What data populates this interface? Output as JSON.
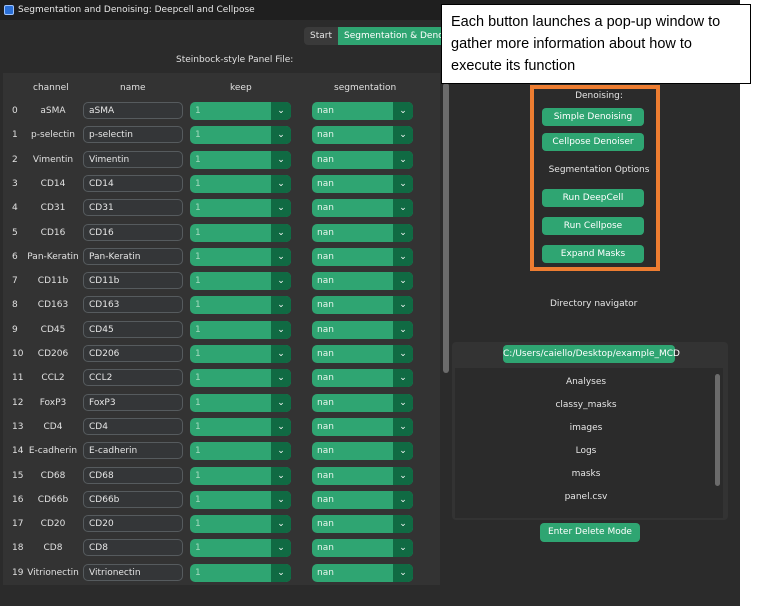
{
  "window": {
    "title": "Segmentation and Denoising: Deepcell and Cellpose"
  },
  "tabs": [
    {
      "label": "Start"
    },
    {
      "label": "Segmentation & Denoising"
    }
  ],
  "panel_file_label": "Steinbock-style Panel File:",
  "table": {
    "headers": {
      "channel": "channel",
      "name": "name",
      "keep": "keep",
      "segmentation": "segmentation"
    },
    "rows": [
      {
        "index": "0",
        "channel": "aSMA",
        "name": "aSMA",
        "keep": "1",
        "segmentation": "nan"
      },
      {
        "index": "1",
        "channel": "p-selectin",
        "name": "p-selectin",
        "keep": "1",
        "segmentation": "nan"
      },
      {
        "index": "2",
        "channel": "Vimentin",
        "name": "Vimentin",
        "keep": "1",
        "segmentation": "nan"
      },
      {
        "index": "3",
        "channel": "CD14",
        "name": "CD14",
        "keep": "1",
        "segmentation": "nan"
      },
      {
        "index": "4",
        "channel": "CD31",
        "name": "CD31",
        "keep": "1",
        "segmentation": "nan"
      },
      {
        "index": "5",
        "channel": "CD16",
        "name": "CD16",
        "keep": "1",
        "segmentation": "nan"
      },
      {
        "index": "6",
        "channel": "Pan-Keratin",
        "name": "Pan-Keratin",
        "keep": "1",
        "segmentation": "nan"
      },
      {
        "index": "7",
        "channel": "CD11b",
        "name": "CD11b",
        "keep": "1",
        "segmentation": "nan"
      },
      {
        "index": "8",
        "channel": "CD163",
        "name": "CD163",
        "keep": "1",
        "segmentation": "nan"
      },
      {
        "index": "9",
        "channel": "CD45",
        "name": "CD45",
        "keep": "1",
        "segmentation": "nan"
      },
      {
        "index": "10",
        "channel": "CD206",
        "name": "CD206",
        "keep": "1",
        "segmentation": "nan"
      },
      {
        "index": "11",
        "channel": "CCL2",
        "name": "CCL2",
        "keep": "1",
        "segmentation": "nan"
      },
      {
        "index": "12",
        "channel": "FoxP3",
        "name": "FoxP3",
        "keep": "1",
        "segmentation": "nan"
      },
      {
        "index": "13",
        "channel": "CD4",
        "name": "CD4",
        "keep": "1",
        "segmentation": "nan"
      },
      {
        "index": "14",
        "channel": "E-cadherin",
        "name": "E-cadherin",
        "keep": "1",
        "segmentation": "nan"
      },
      {
        "index": "15",
        "channel": "CD68",
        "name": "CD68",
        "keep": "1",
        "segmentation": "nan"
      },
      {
        "index": "16",
        "channel": "CD66b",
        "name": "CD66b",
        "keep": "1",
        "segmentation": "nan"
      },
      {
        "index": "17",
        "channel": "CD20",
        "name": "CD20",
        "keep": "1",
        "segmentation": "nan"
      },
      {
        "index": "18",
        "channel": "CD8",
        "name": "CD8",
        "keep": "1",
        "segmentation": "nan"
      },
      {
        "index": "19",
        "channel": "Vitrionectin",
        "name": "Vitrionectin",
        "keep": "1",
        "segmentation": "nan"
      }
    ]
  },
  "callout": {
    "text": "Each button launches a pop-up window to gather more information about how to execute its function"
  },
  "actions": {
    "denoising_label": "Denoising:",
    "simple_denoising": "Simple Denoising",
    "cellpose_denoiser": "Cellpose Denoiser",
    "segmentation_label": "Segmentation Options",
    "run_deepcell": "Run DeepCell",
    "run_cellpose": "Run Cellpose",
    "expand_masks": "Expand Masks"
  },
  "directory": {
    "label": "Directory navigator",
    "path": "C:/Users/caiello/Desktop/example_MCD",
    "items": [
      "Analyses",
      "classy_masks",
      "images",
      "Logs",
      "masks",
      "panel.csv"
    ],
    "delete_button": "Enter Delete Mode"
  },
  "colors": {
    "accent": "#2fa572",
    "accent_dark": "#106a43",
    "highlight": "#ed7d31",
    "background": "#2b2b2b"
  },
  "icons": {
    "dropdown": "chevron-down-icon",
    "app": "app-icon"
  }
}
